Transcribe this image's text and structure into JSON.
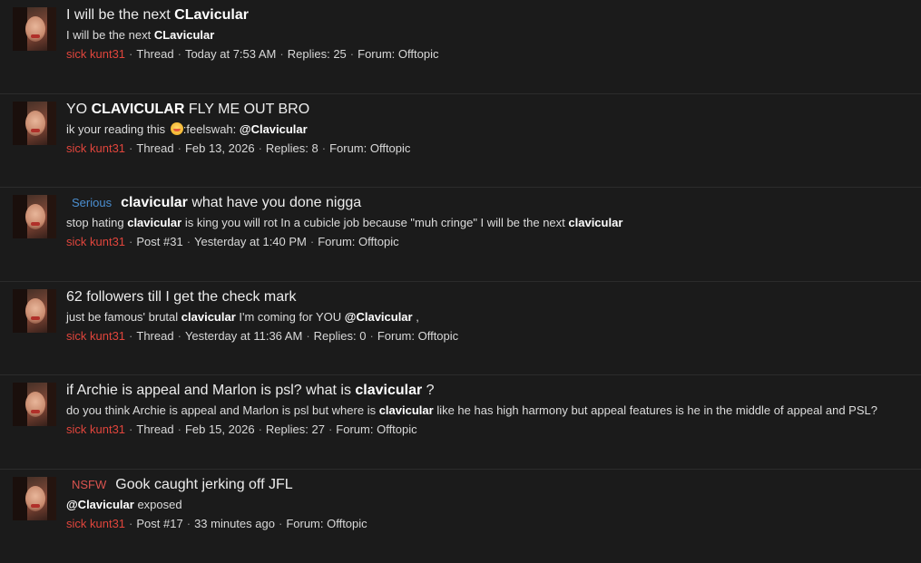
{
  "results": [
    {
      "prefix": "",
      "title_pre": "I will be the next ",
      "title_bold": "CLavicular",
      "title_post": "",
      "snippet_pre": "I will be the next ",
      "snippet_bold": "CLavicular",
      "snippet_post": "",
      "user": "sick kunt31",
      "type": "Thread",
      "date": "Today at 7:53 AM",
      "extra": "Replies: 25",
      "forum": "Forum: Offtopic"
    },
    {
      "prefix": "",
      "title_pre": "YO ",
      "title_bold": "CLAVICULAR",
      "title_post": " FLY ME OUT BRO",
      "snippet_pre": "ik your reading this ",
      "snippet_emoji": "grimace-emoji-icon",
      "snippet_post2": ":feelswah: ",
      "snippet_bold": "@Clavicular",
      "snippet_post": "",
      "user": "sick kunt31",
      "type": "Thread",
      "date": "Feb 13, 2026",
      "extra": "Replies: 8",
      "forum": "Forum: Offtopic"
    },
    {
      "prefix": "Serious",
      "title_pre": "",
      "title_bold": "clavicular",
      "title_post": " what have you done nigga",
      "snippet_pre": "stop hating ",
      "snippet_bold": "clavicular",
      "snippet_post": " is king you will rot In a cubicle job because \"muh cringe\" I will be the next ",
      "snippet_bold2": "clavicular",
      "user": "sick kunt31",
      "type": "Post #31",
      "date": "Yesterday at 1:40 PM",
      "extra": "",
      "forum": "Forum: Offtopic"
    },
    {
      "prefix": "",
      "title_pre": "62 followers till I get the check mark",
      "title_bold": "",
      "title_post": "",
      "snippet_pre": "just be famous' brutal ",
      "snippet_bold": "clavicular",
      "snippet_post": " I'm coming for YOU ",
      "snippet_bold2": "@Clavicular",
      "snippet_post2": " ,",
      "user": "sick kunt31",
      "type": "Thread",
      "date": "Yesterday at 11:36 AM",
      "extra": "Replies: 0",
      "forum": "Forum: Offtopic"
    },
    {
      "prefix": "",
      "title_pre": "if Archie is appeal and Marlon is psl? what is ",
      "title_bold": "clavicular",
      "title_post": " ?",
      "snippet_pre": "do you think Archie is appeal and Marlon is psl but where is ",
      "snippet_bold": "clavicular",
      "snippet_post": " like he has high harmony but appeal features is he in the middle of appeal and PSL?",
      "user": "sick kunt31",
      "type": "Thread",
      "date": "Feb 15, 2026",
      "extra": "Replies: 27",
      "forum": "Forum: Offtopic"
    },
    {
      "prefix": "NSFW",
      "title_pre": "Gook caught jerking off JFL",
      "title_bold": "",
      "title_post": "",
      "snippet_pre": "",
      "snippet_bold": "@Clavicular",
      "snippet_post": " exposed",
      "user": "sick kunt31",
      "type": "Post #17",
      "date": "33 minutes ago",
      "extra": "",
      "forum": "Forum: Offtopic"
    }
  ],
  "separator": "·",
  "colors": {
    "background": "#1b1b1b",
    "username": "#e0453c",
    "serious_prefix": "#4b8fd1",
    "nsfw_prefix": "#d9534f"
  }
}
